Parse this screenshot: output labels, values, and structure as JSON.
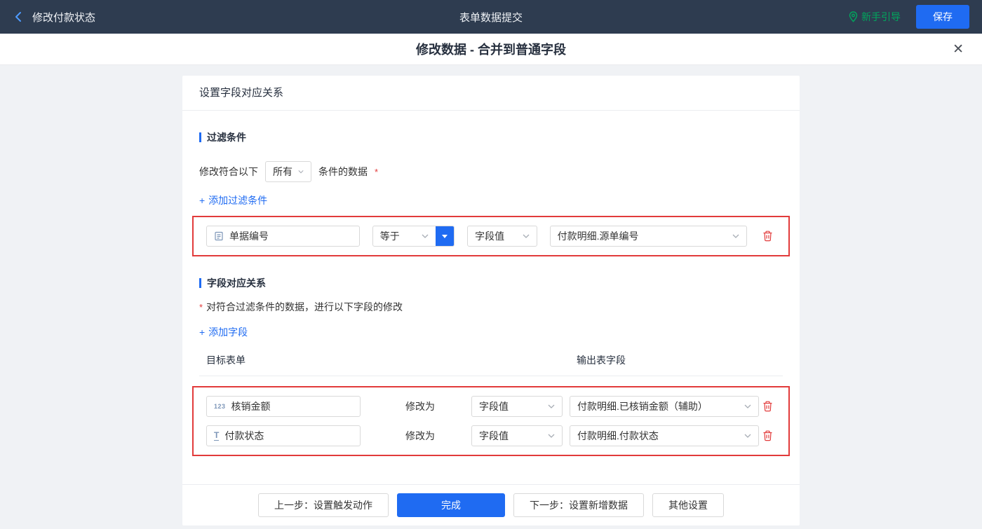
{
  "colors": {
    "topbar_bg": "#2e3c50",
    "accent_blue": "#1f6bf2",
    "guide_green": "#00a75d",
    "highlight_red": "#e23b3b"
  },
  "topbar": {
    "back_label": "修改付款状态",
    "title": "表单数据提交",
    "guide_label": "新手引导",
    "save_label": "保存"
  },
  "modal": {
    "title": "修改数据 - 合并到普通字段",
    "close_glyph": "✕"
  },
  "panel": {
    "header": "设置字段对应关系",
    "plus_glyph": "+",
    "filter": {
      "title": "过滤条件",
      "cond_prefix": "修改符合以下",
      "cond_match": "所有",
      "cond_suffix": "条件的数据",
      "required_mark": "*",
      "add_link": "添加过滤条件",
      "row": {
        "field_label": "单据编号",
        "operator": "等于",
        "value_type": "字段值",
        "value_field": "付款明细.源单编号"
      }
    },
    "mapping": {
      "title": "字段对应关系",
      "required_mark": "*",
      "description": "对符合过滤条件的数据，进行以下字段的修改",
      "add_link": "添加字段",
      "columns": {
        "target": "目标表单",
        "output": "输出表字段"
      },
      "rows": [
        {
          "icon": "123",
          "field_label": "核销金额",
          "action_label": "修改为",
          "value_type": "字段值",
          "value_field": "付款明细.已核销金额（辅助）"
        },
        {
          "icon": "T",
          "field_label": "付款状态",
          "action_label": "修改为",
          "value_type": "字段值",
          "value_field": "付款明细.付款状态"
        }
      ]
    },
    "footer": {
      "prev_label": "上一步：设置触发动作",
      "done_label": "完成",
      "next_label": "下一步：设置新增数据",
      "other_label": "其他设置"
    }
  }
}
